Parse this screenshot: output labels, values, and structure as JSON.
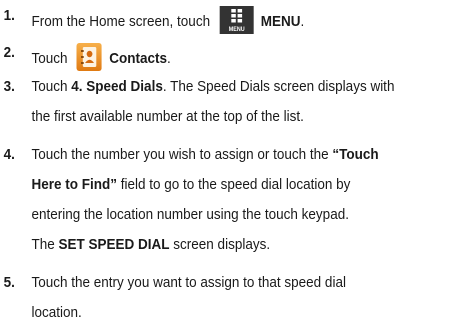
{
  "steps": [
    {
      "number": "1.",
      "parts": [
        "From the Home screen, touch",
        "MENU",
        "."
      ],
      "icon": {
        "name": "menu-icon",
        "label": "MENU"
      }
    },
    {
      "number": "2.",
      "parts": [
        "Touch",
        "Contacts",
        "."
      ],
      "icon": {
        "name": "contacts-icon"
      }
    },
    {
      "number": "3.",
      "line1": [
        "Touch ",
        "4. Speed Dials",
        ". The Speed Dials screen displays with"
      ],
      "line2": "the first available number at the top of the list."
    },
    {
      "number": "4.",
      "line1": [
        "Touch the number you wish to assign or touch the ",
        "“Touch"
      ],
      "line2": [
        "Here to Find”",
        " field to go to the speed dial location by"
      ],
      "line3": "entering the location number using the touch keypad.",
      "line4": [
        "The ",
        "SET SPEED DIAL",
        " screen displays."
      ]
    },
    {
      "number": "5.",
      "line1": "Touch the entry you want to assign to that speed dial",
      "line2": "location."
    }
  ]
}
